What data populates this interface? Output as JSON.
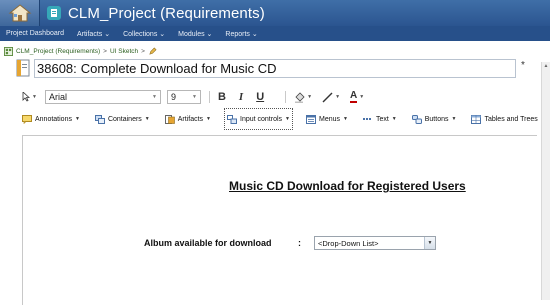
{
  "app": {
    "title": "CLM_Project (Requirements)"
  },
  "nav": {
    "items": [
      "Project Dashboard",
      "Artifacts ⌄",
      "Collections ⌄",
      "Modules ⌄",
      "Reports ⌄"
    ]
  },
  "breadcrumb": {
    "project": "CLM_Project (Requirements)",
    "separator": ">",
    "folder": "UI Sketch",
    "separator2": ">"
  },
  "artifact": {
    "id": "38608:",
    "name": "Complete Download for Music CD",
    "required_mark": "*"
  },
  "format_toolbar": {
    "font": "Arial",
    "size": "9",
    "bold": "B",
    "italic": "I",
    "underline": "U",
    "text_color": "A"
  },
  "insert_toolbar": {
    "items": [
      "Annotations",
      "Containers",
      "Artifacts",
      "Input controls",
      "Menus",
      "Text",
      "Buttons",
      "Tables and Trees"
    ],
    "active": "Input controls"
  },
  "sketch": {
    "title": "Music CD Download for Registered Users",
    "field_label": "Album available for download",
    "colon": ":",
    "dropdown_value": "<Drop-Down List>"
  },
  "icons": {
    "home": "home-icon",
    "project": "project-icon",
    "artifact": "artifact-icon",
    "pointer": "pointer-icon",
    "fill": "fill-color-icon",
    "line": "line-style-icon",
    "text_color": "text-color-icon"
  },
  "colors": {
    "titlebar": "#2b5590",
    "navbar": "#27508a",
    "breadcrumb_link": "#2b5f1f"
  }
}
